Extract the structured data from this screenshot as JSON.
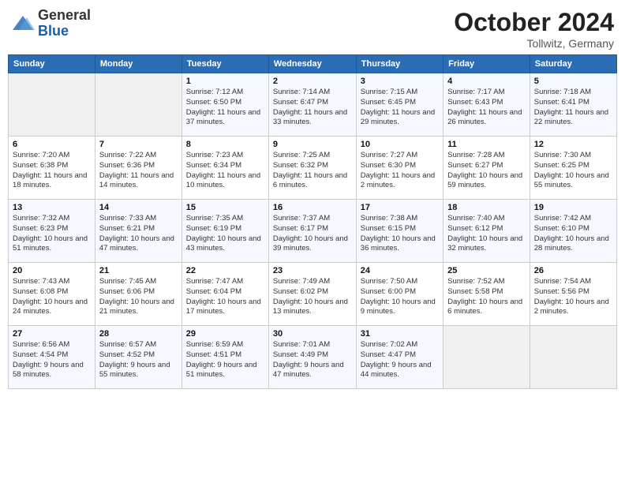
{
  "header": {
    "logo_line1": "General",
    "logo_line2": "Blue",
    "month": "October 2024",
    "location": "Tollwitz, Germany"
  },
  "weekdays": [
    "Sunday",
    "Monday",
    "Tuesday",
    "Wednesday",
    "Thursday",
    "Friday",
    "Saturday"
  ],
  "weeks": [
    [
      {
        "day": "",
        "info": ""
      },
      {
        "day": "",
        "info": ""
      },
      {
        "day": "1",
        "info": "Sunrise: 7:12 AM\nSunset: 6:50 PM\nDaylight: 11 hours and 37 minutes."
      },
      {
        "day": "2",
        "info": "Sunrise: 7:14 AM\nSunset: 6:47 PM\nDaylight: 11 hours and 33 minutes."
      },
      {
        "day": "3",
        "info": "Sunrise: 7:15 AM\nSunset: 6:45 PM\nDaylight: 11 hours and 29 minutes."
      },
      {
        "day": "4",
        "info": "Sunrise: 7:17 AM\nSunset: 6:43 PM\nDaylight: 11 hours and 26 minutes."
      },
      {
        "day": "5",
        "info": "Sunrise: 7:18 AM\nSunset: 6:41 PM\nDaylight: 11 hours and 22 minutes."
      }
    ],
    [
      {
        "day": "6",
        "info": "Sunrise: 7:20 AM\nSunset: 6:38 PM\nDaylight: 11 hours and 18 minutes."
      },
      {
        "day": "7",
        "info": "Sunrise: 7:22 AM\nSunset: 6:36 PM\nDaylight: 11 hours and 14 minutes."
      },
      {
        "day": "8",
        "info": "Sunrise: 7:23 AM\nSunset: 6:34 PM\nDaylight: 11 hours and 10 minutes."
      },
      {
        "day": "9",
        "info": "Sunrise: 7:25 AM\nSunset: 6:32 PM\nDaylight: 11 hours and 6 minutes."
      },
      {
        "day": "10",
        "info": "Sunrise: 7:27 AM\nSunset: 6:30 PM\nDaylight: 11 hours and 2 minutes."
      },
      {
        "day": "11",
        "info": "Sunrise: 7:28 AM\nSunset: 6:27 PM\nDaylight: 10 hours and 59 minutes."
      },
      {
        "day": "12",
        "info": "Sunrise: 7:30 AM\nSunset: 6:25 PM\nDaylight: 10 hours and 55 minutes."
      }
    ],
    [
      {
        "day": "13",
        "info": "Sunrise: 7:32 AM\nSunset: 6:23 PM\nDaylight: 10 hours and 51 minutes."
      },
      {
        "day": "14",
        "info": "Sunrise: 7:33 AM\nSunset: 6:21 PM\nDaylight: 10 hours and 47 minutes."
      },
      {
        "day": "15",
        "info": "Sunrise: 7:35 AM\nSunset: 6:19 PM\nDaylight: 10 hours and 43 minutes."
      },
      {
        "day": "16",
        "info": "Sunrise: 7:37 AM\nSunset: 6:17 PM\nDaylight: 10 hours and 39 minutes."
      },
      {
        "day": "17",
        "info": "Sunrise: 7:38 AM\nSunset: 6:15 PM\nDaylight: 10 hours and 36 minutes."
      },
      {
        "day": "18",
        "info": "Sunrise: 7:40 AM\nSunset: 6:12 PM\nDaylight: 10 hours and 32 minutes."
      },
      {
        "day": "19",
        "info": "Sunrise: 7:42 AM\nSunset: 6:10 PM\nDaylight: 10 hours and 28 minutes."
      }
    ],
    [
      {
        "day": "20",
        "info": "Sunrise: 7:43 AM\nSunset: 6:08 PM\nDaylight: 10 hours and 24 minutes."
      },
      {
        "day": "21",
        "info": "Sunrise: 7:45 AM\nSunset: 6:06 PM\nDaylight: 10 hours and 21 minutes."
      },
      {
        "day": "22",
        "info": "Sunrise: 7:47 AM\nSunset: 6:04 PM\nDaylight: 10 hours and 17 minutes."
      },
      {
        "day": "23",
        "info": "Sunrise: 7:49 AM\nSunset: 6:02 PM\nDaylight: 10 hours and 13 minutes."
      },
      {
        "day": "24",
        "info": "Sunrise: 7:50 AM\nSunset: 6:00 PM\nDaylight: 10 hours and 9 minutes."
      },
      {
        "day": "25",
        "info": "Sunrise: 7:52 AM\nSunset: 5:58 PM\nDaylight: 10 hours and 6 minutes."
      },
      {
        "day": "26",
        "info": "Sunrise: 7:54 AM\nSunset: 5:56 PM\nDaylight: 10 hours and 2 minutes."
      }
    ],
    [
      {
        "day": "27",
        "info": "Sunrise: 6:56 AM\nSunset: 4:54 PM\nDaylight: 9 hours and 58 minutes."
      },
      {
        "day": "28",
        "info": "Sunrise: 6:57 AM\nSunset: 4:52 PM\nDaylight: 9 hours and 55 minutes."
      },
      {
        "day": "29",
        "info": "Sunrise: 6:59 AM\nSunset: 4:51 PM\nDaylight: 9 hours and 51 minutes."
      },
      {
        "day": "30",
        "info": "Sunrise: 7:01 AM\nSunset: 4:49 PM\nDaylight: 9 hours and 47 minutes."
      },
      {
        "day": "31",
        "info": "Sunrise: 7:02 AM\nSunset: 4:47 PM\nDaylight: 9 hours and 44 minutes."
      },
      {
        "day": "",
        "info": ""
      },
      {
        "day": "",
        "info": ""
      }
    ]
  ]
}
